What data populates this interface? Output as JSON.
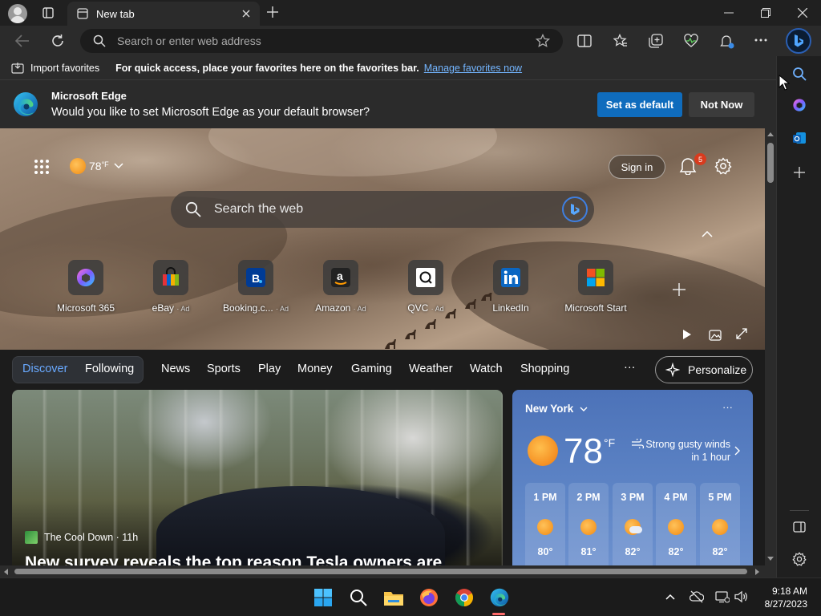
{
  "browser": {
    "tab_title": "New tab",
    "address_placeholder": "Search or enter web address"
  },
  "favorites_bar": {
    "import_label": "Import favorites",
    "hint": "For quick access, place your favorites here on the favorites bar.",
    "manage_link": "Manage favorites now"
  },
  "banner": {
    "title": "Microsoft Edge",
    "message": "Would you like to set Microsoft Edge as your default browser?",
    "set_default": "Set as default",
    "not_now": "Not Now"
  },
  "hero": {
    "temperature": "78",
    "temp_unit": "°F",
    "sign_in": "Sign in",
    "notification_count": "5",
    "search_placeholder": "Search the web"
  },
  "quick_links": [
    {
      "label": "Microsoft 365",
      "ad": ""
    },
    {
      "label": "eBay",
      "ad": "· Ad"
    },
    {
      "label": "Booking.c...",
      "ad": "· Ad"
    },
    {
      "label": "Amazon",
      "ad": "· Ad"
    },
    {
      "label": "QVC",
      "ad": "· Ad"
    },
    {
      "label": "LinkedIn",
      "ad": ""
    },
    {
      "label": "Microsoft Start",
      "ad": ""
    }
  ],
  "feed_nav": {
    "discover": "Discover",
    "following": "Following",
    "items": [
      "News",
      "Sports",
      "Play",
      "Money",
      "Gaming",
      "Weather",
      "Watch",
      "Shopping"
    ],
    "more": "···",
    "personalize": "Personalize"
  },
  "news_card": {
    "source": "The Cool Down · 11h",
    "headline": "New survey reveals the top reason Tesla owners are"
  },
  "weather": {
    "location": "New York",
    "temperature": "78",
    "unit": "°F",
    "alert_line1": "Strong gusty winds",
    "alert_line2": "in 1 hour",
    "more": "···",
    "hourly": [
      {
        "time": "1 PM",
        "temp": "80°"
      },
      {
        "time": "2 PM",
        "temp": "81°"
      },
      {
        "time": "3 PM",
        "temp": "82°"
      },
      {
        "time": "4 PM",
        "temp": "82°"
      },
      {
        "time": "5 PM",
        "temp": "82°"
      }
    ]
  },
  "taskbar": {
    "time": "9:18 AM",
    "date": "8/27/2023"
  },
  "colors": {
    "accent": "#0f6cbd",
    "link": "#73b5ff",
    "weather_bg": "#5f86c7"
  }
}
